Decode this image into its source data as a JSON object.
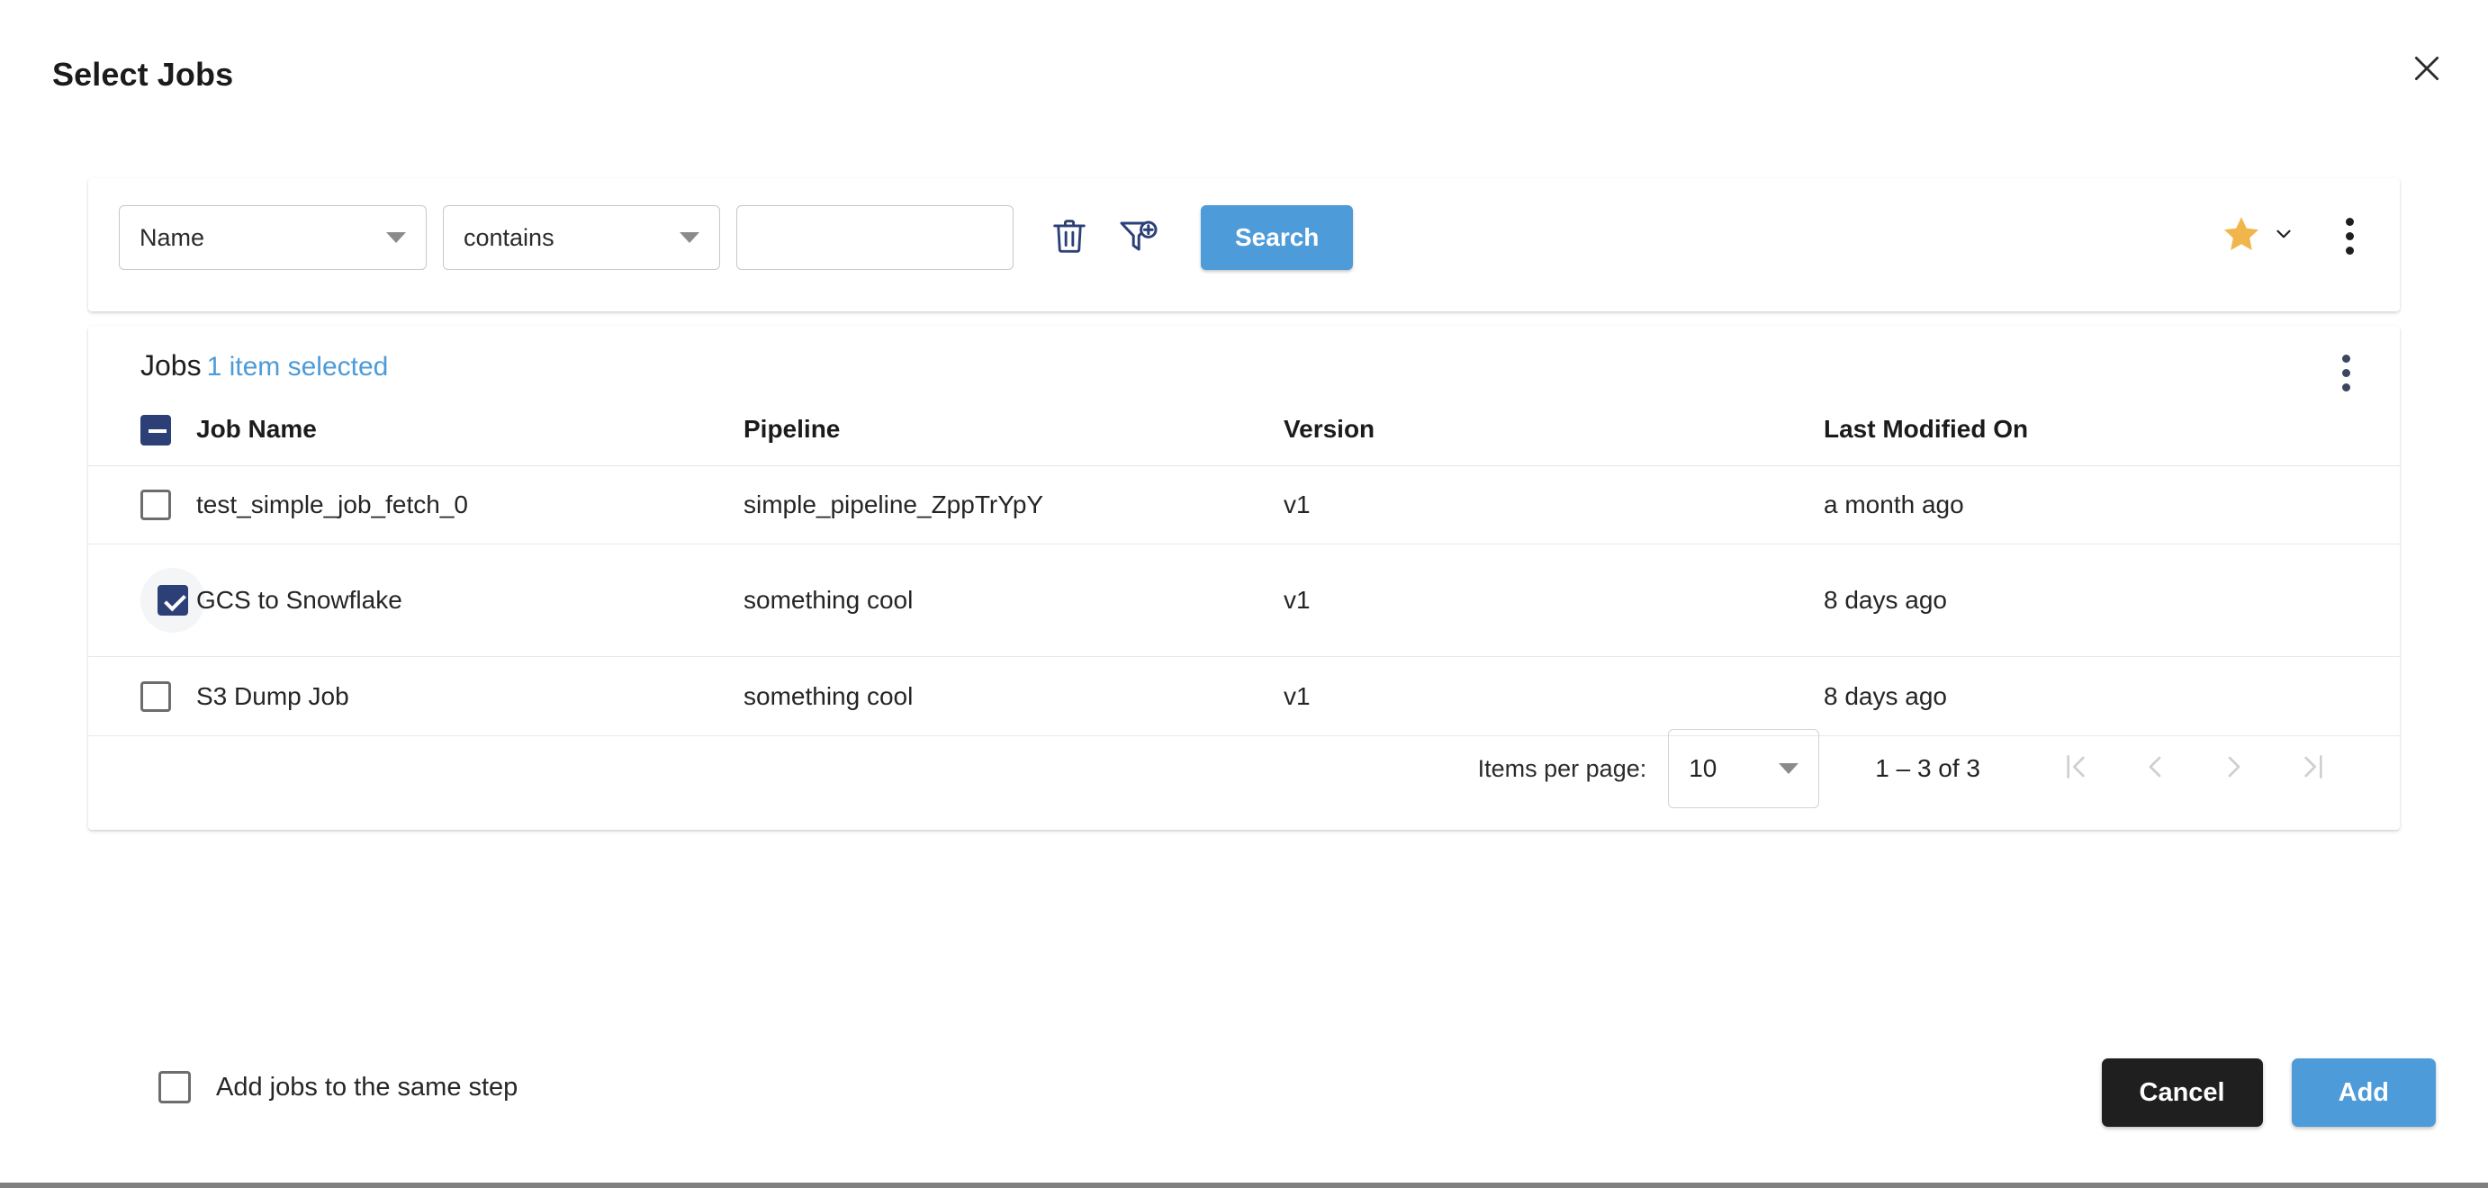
{
  "dialog": {
    "title": "Select Jobs",
    "close_icon": "close-icon"
  },
  "filter_bar": {
    "field_select": {
      "value": "Name",
      "icon": "chevron-down-icon"
    },
    "operator_select": {
      "value": "contains",
      "icon": "chevron-down-icon"
    },
    "value_input": {
      "value": "",
      "placeholder": ""
    },
    "delete_icon": "trash-icon",
    "add_filter_icon": "filter-add-icon",
    "search_label": "Search",
    "favorite_icon": "star-icon",
    "favorite_caret_icon": "chevron-down-icon",
    "more_icon": "kebab-menu-icon"
  },
  "jobs_card": {
    "title": "Jobs",
    "selection_text": "1 item selected",
    "more_icon": "kebab-menu-icon",
    "columns": [
      "Job Name",
      "Pipeline",
      "Version",
      "Last Modified On"
    ],
    "header_checkbox_state": "indeterminate",
    "rows": [
      {
        "checked": false,
        "job_name": "test_simple_job_fetch_0",
        "pipeline": "simple_pipeline_ZppTrYpY",
        "version": "v1",
        "last_modified": "a month ago"
      },
      {
        "checked": true,
        "job_name": "GCS to Snowflake",
        "pipeline": "something cool",
        "version": "v1",
        "last_modified": "8 days ago"
      },
      {
        "checked": false,
        "job_name": "S3 Dump Job",
        "pipeline": "something cool",
        "version": "v1",
        "last_modified": "8 days ago"
      }
    ]
  },
  "paginator": {
    "items_per_page_label": "Items per page:",
    "items_per_page_value": "10",
    "range_label": "1 – 3 of 3",
    "first_page_icon": "first-page-icon",
    "prev_page_icon": "previous-page-icon",
    "next_page_icon": "next-page-icon",
    "last_page_icon": "last-page-icon"
  },
  "footer": {
    "same_step_checkbox_label": "Add jobs to the same step",
    "same_step_checked": false,
    "cancel_label": "Cancel",
    "add_label": "Add"
  },
  "colors": {
    "accent_blue": "#4d9bd8",
    "checkbox_navy": "#2c4077",
    "star_gold": "#f0b64b",
    "cancel_dark": "#1f1f1f",
    "icon_navy": "#2c4077"
  }
}
